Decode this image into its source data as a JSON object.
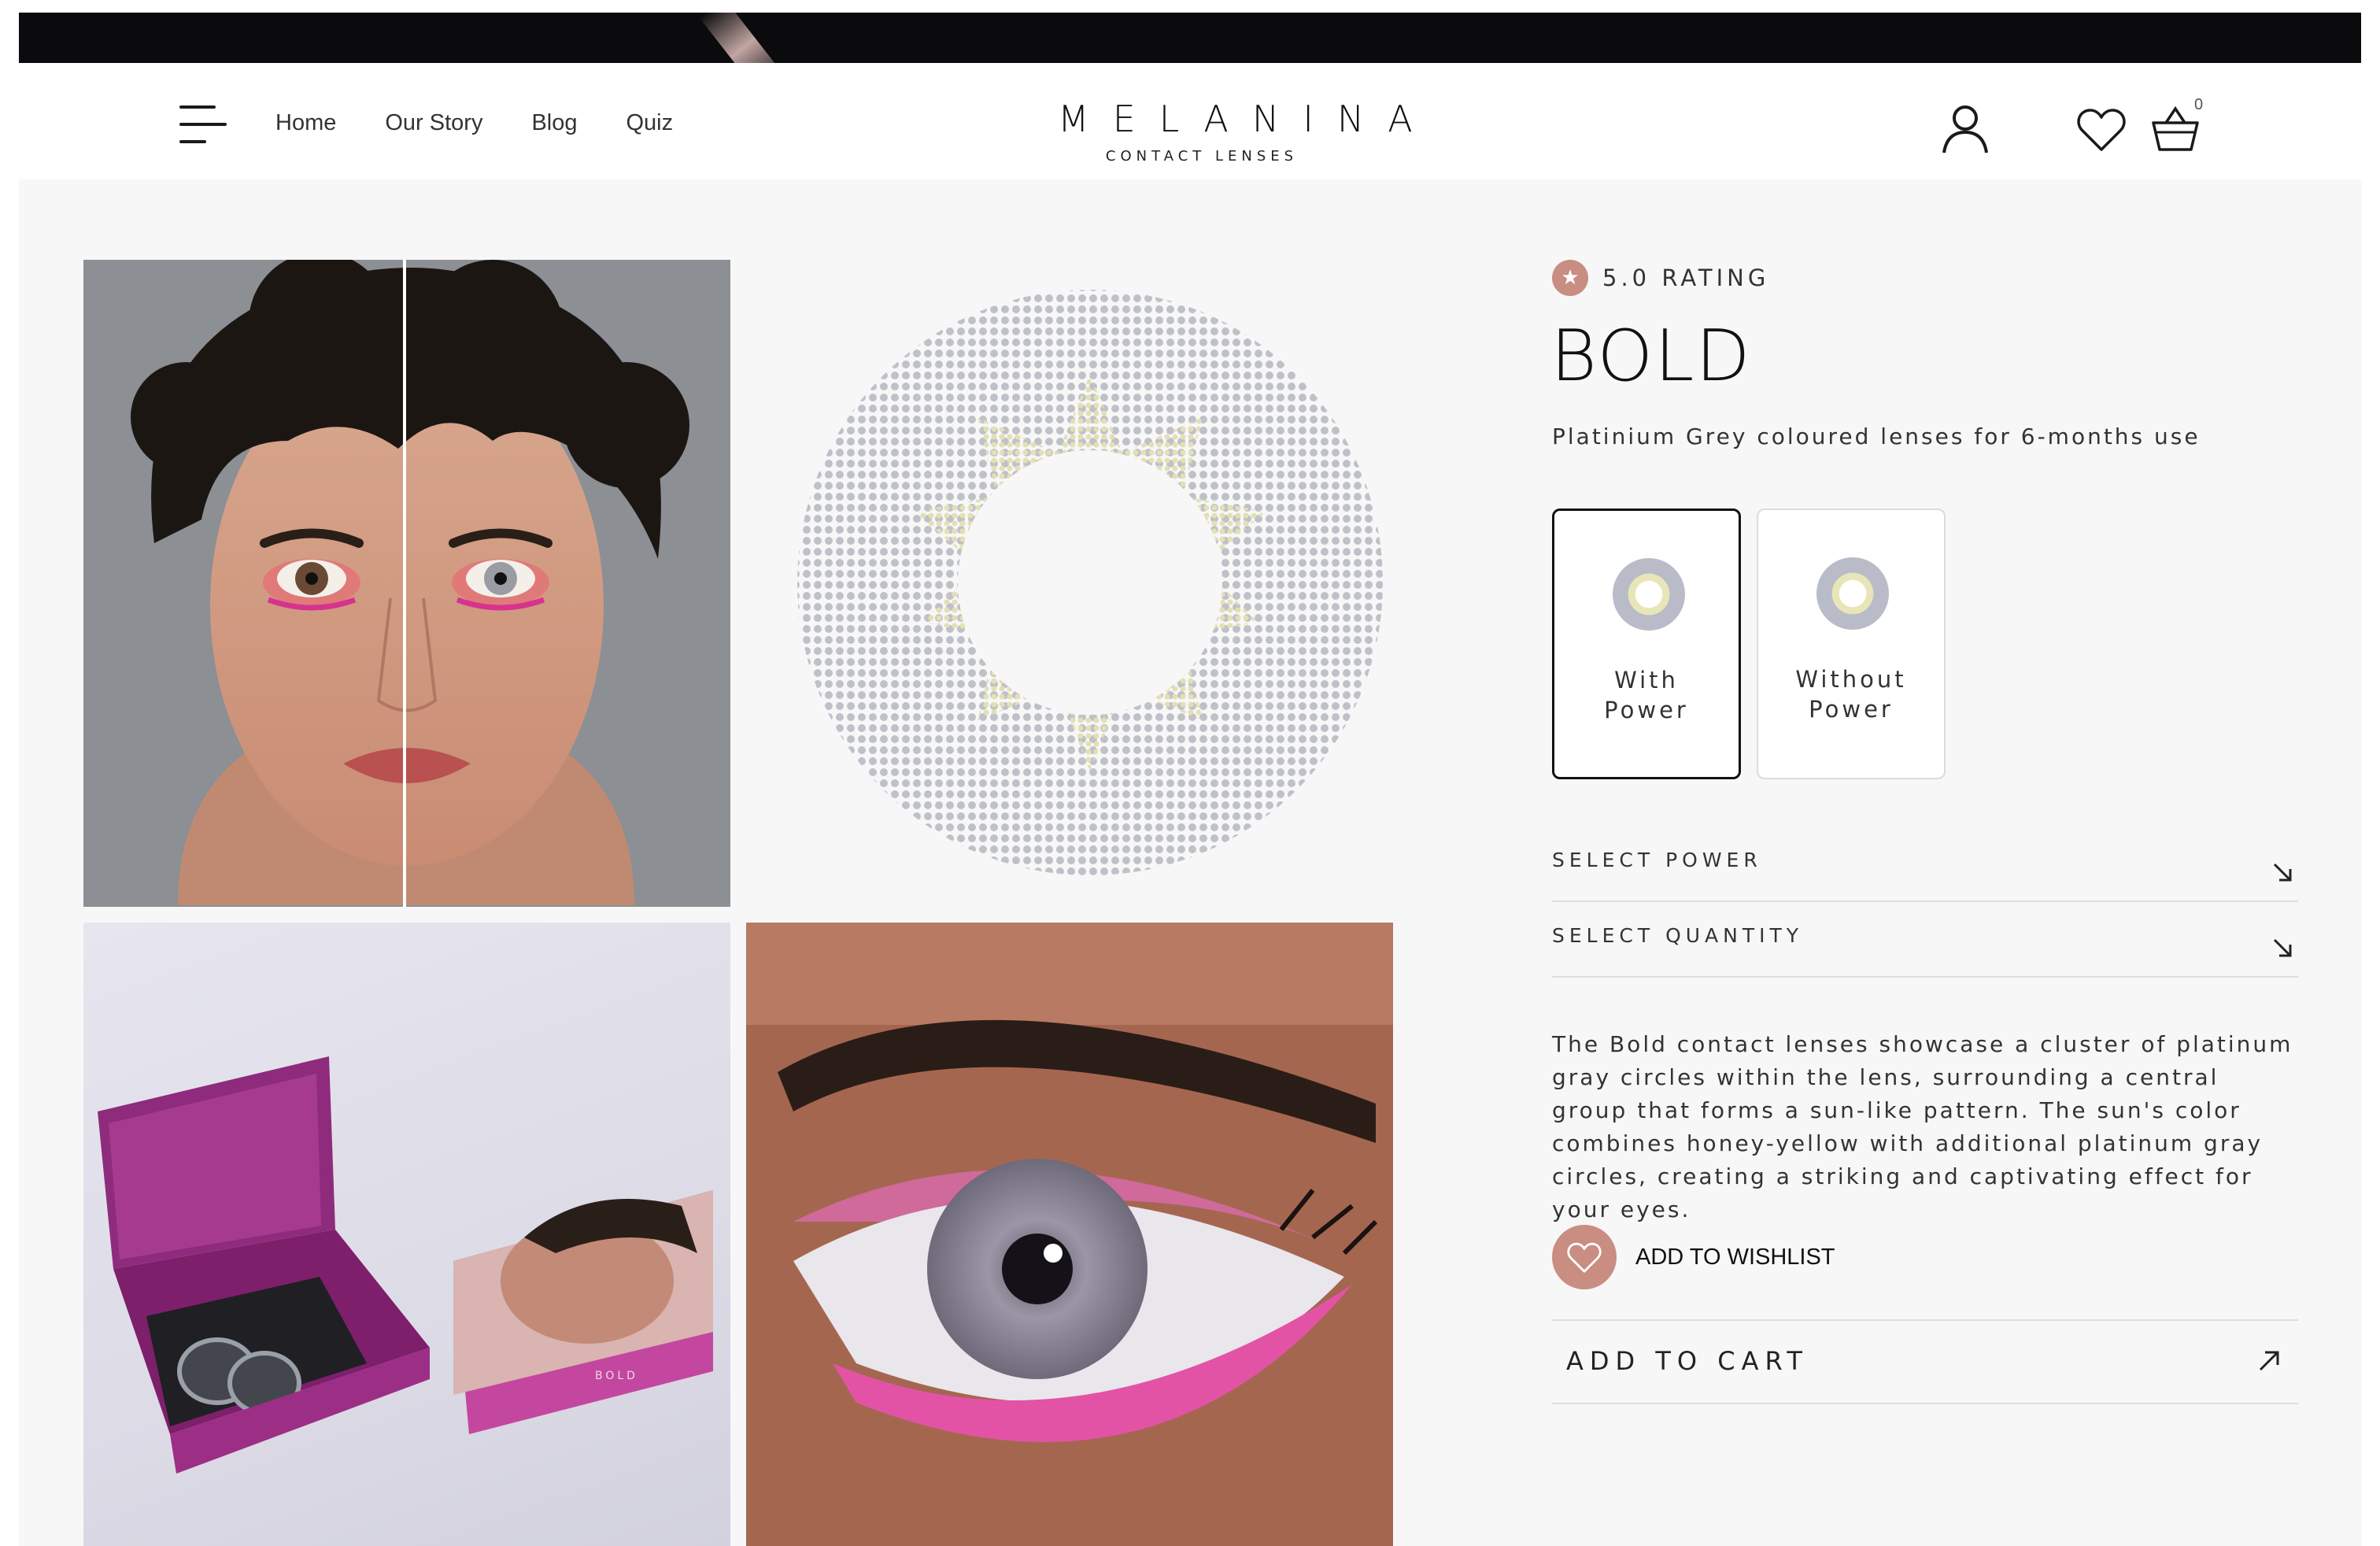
{
  "header": {
    "nav": [
      "Home",
      "Our Story",
      "Blog",
      "Quiz"
    ],
    "brand": "MELANINA",
    "brand_sub": "CONTACT LENSES",
    "cart_count": "0"
  },
  "product": {
    "rating": "5.0 RATING",
    "title": "BOLD",
    "subtitle": "Platinium Grey coloured lenses for 6-months use",
    "options": [
      {
        "label": "With\nPower",
        "selected": true
      },
      {
        "label": "Without\nPower",
        "selected": false
      }
    ],
    "select_power": "SELECT POWER",
    "select_quantity": "SELECT QUANTITY",
    "description": "The Bold contact lenses showcase a cluster of platinum gray circles within the lens, surrounding a central group that forms a sun-like pattern. The sun's color combines honey-yellow with additional platinum gray circles, creating a striking and captivating effect for your eyes.",
    "wishlist": "ADD TO WISHLIST",
    "add_to_cart": "ADD TO CART"
  },
  "box_text": {
    "brand": "BOLD"
  },
  "colors": {
    "accent": "#c98d82",
    "header_bg": "#ffffff",
    "page_bg": "#f7f7f7",
    "promo_bar": "#0b0b0d"
  },
  "icons": [
    "hamburger-icon",
    "user-icon",
    "heart-icon",
    "basket-icon",
    "star-icon",
    "arrow-down-right-icon",
    "arrow-up-right-icon"
  ]
}
